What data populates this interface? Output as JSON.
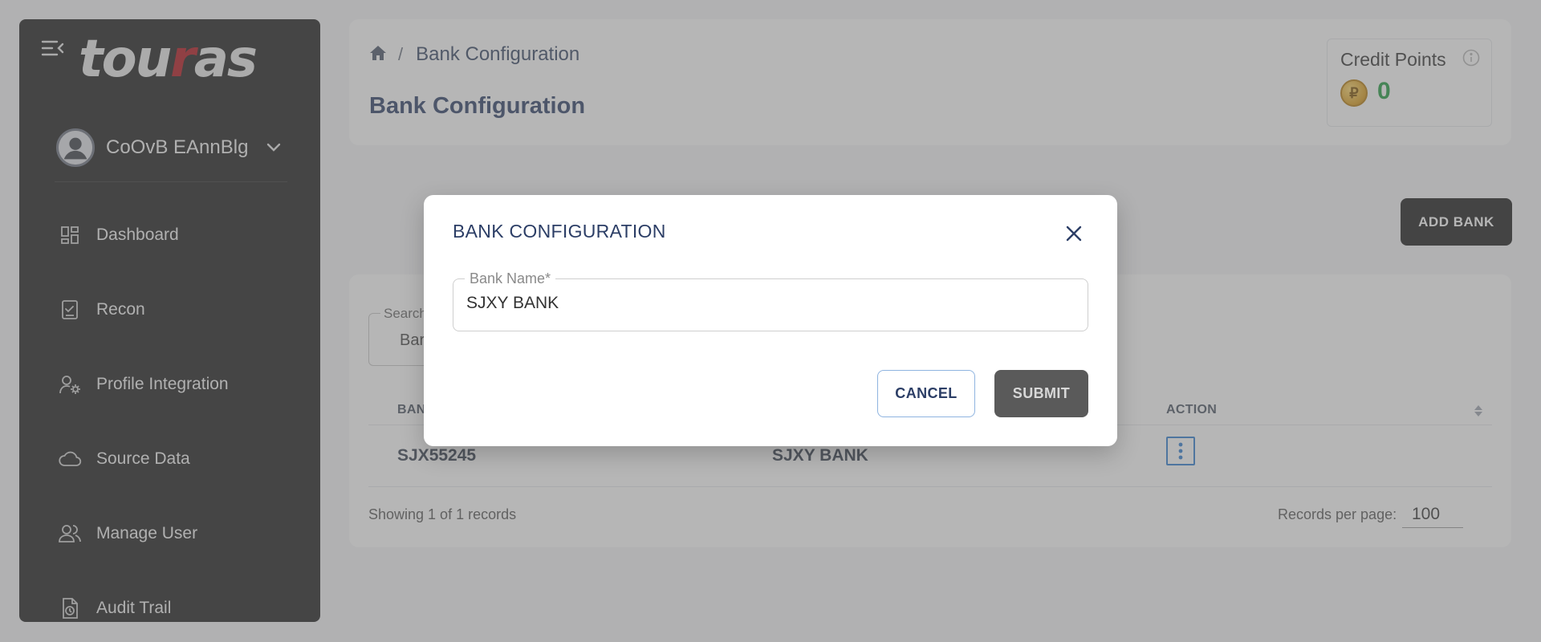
{
  "sidebar": {
    "logo_text_before": "tou",
    "logo_text_accent": "r",
    "logo_text_after": "as",
    "user_name": "CoOvB EAnnBlg",
    "items": [
      {
        "label": "Dashboard",
        "icon": "dashboard-icon"
      },
      {
        "label": "Recon",
        "icon": "recon-icon"
      },
      {
        "label": "Profile Integration",
        "icon": "profile-integration-icon"
      },
      {
        "label": "Source Data",
        "icon": "cloud-icon"
      },
      {
        "label": "Manage User",
        "icon": "users-icon"
      },
      {
        "label": "Audit Trail",
        "icon": "audit-trail-icon"
      }
    ]
  },
  "header": {
    "breadcrumb_separator": "/",
    "breadcrumb_current": "Bank Configuration",
    "page_title": "Bank Configuration"
  },
  "credits": {
    "title": "Credit Points",
    "coin_symbol": "₽",
    "value": "0"
  },
  "actions": {
    "add_bank_label": "ADD BANK"
  },
  "table": {
    "search_label": "Search",
    "search_value": "Bar",
    "columns": [
      "BAN",
      "ACTION"
    ],
    "rows": [
      {
        "code": "SJX55245",
        "name": "SJXY BANK"
      }
    ],
    "footer_text": "Showing 1 of 1 records",
    "records_per_page_label": "Records per page:",
    "records_per_page_value": "100"
  },
  "modal": {
    "title": "BANK CONFIGURATION",
    "field_label": "Bank Name*",
    "field_value": "SJXY BANK",
    "cancel_label": "CANCEL",
    "submit_label": "SUBMIT"
  },
  "colors": {
    "sidebar_bg": "#1c1c1c",
    "accent_red": "#b3121a",
    "title_blue": "#2c3e66",
    "credit_green": "#1e9a3e"
  }
}
